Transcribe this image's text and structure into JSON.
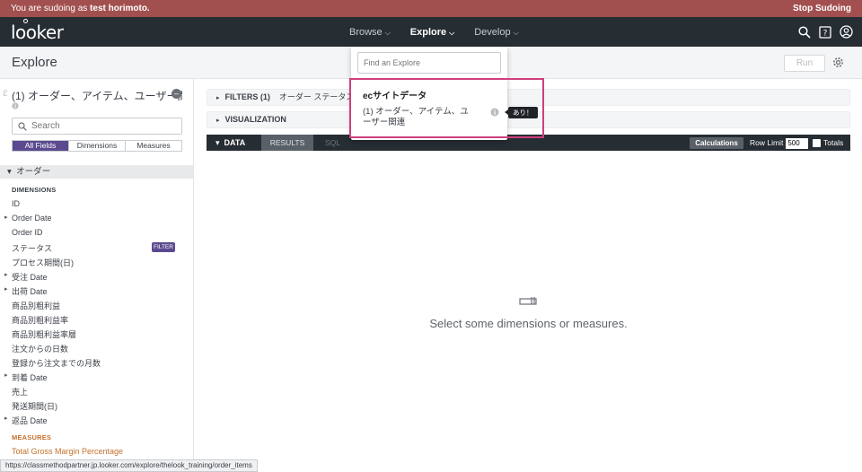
{
  "sudo": {
    "prefix": "You are sudoing as ",
    "user": "test horimoto.",
    "stop_label": "Stop Sudoing"
  },
  "app": {
    "logo": "looker"
  },
  "nav": {
    "browse": "Browse",
    "explore": "Explore",
    "develop": "Develop"
  },
  "page": {
    "title": "Explore",
    "run_label": "Run"
  },
  "sidebar": {
    "explore_name": "(1) オーダー、アイテム、ユーザー関連",
    "search_placeholder": "Search",
    "tabs": [
      "All Fields",
      "Dimensions",
      "Measures"
    ],
    "group_name": "オーダー",
    "dimensions_header": "DIMENSIONS",
    "dimensions": [
      "ID",
      "Order Date",
      "Order ID",
      "ステータス",
      "プロセス期間(日)",
      "受注 Date",
      "出荷 Date",
      "商品別粗利益",
      "商品別粗利益率",
      "商品別粗利益率層",
      "注文からの日数",
      "登録から注文までの月数",
      "到着 Date",
      "売上",
      "発送期間(日)",
      "返品 Date"
    ],
    "filter_tag": "FILTER",
    "measures_header": "MEASURES",
    "measures": [
      "Total Gross Margin Percentage"
    ]
  },
  "main": {
    "filters_label": "FILTERS (1)",
    "filters_summary": "オーダー ステータス i",
    "visualization_label": "VISUALIZATION",
    "data_label": "DATA",
    "results_label": "RESULTS",
    "sql_label": "SQL",
    "calculations_label": "Calculations",
    "row_limit_label": "Row Limit",
    "row_limit_value": "500",
    "totals_label": "Totals",
    "empty_message": "Select some dimensions or measures."
  },
  "dropdown": {
    "search_placeholder": "Find an Explore",
    "group": "ecサイトデータ",
    "item": "(1) オーダー、アイテム、ユーザー関連",
    "tooltip": "あり！"
  },
  "status_url": "https://classmethodpartner.jp.looker.com/explore/thelook_training/order_items",
  "colors": {
    "sudo_bar": "#a1504f",
    "nav_bg": "#262d33",
    "accent_purple": "#5b4a8f",
    "measure_orange": "#c5702b",
    "highlight_pink": "#cf3f7e"
  }
}
